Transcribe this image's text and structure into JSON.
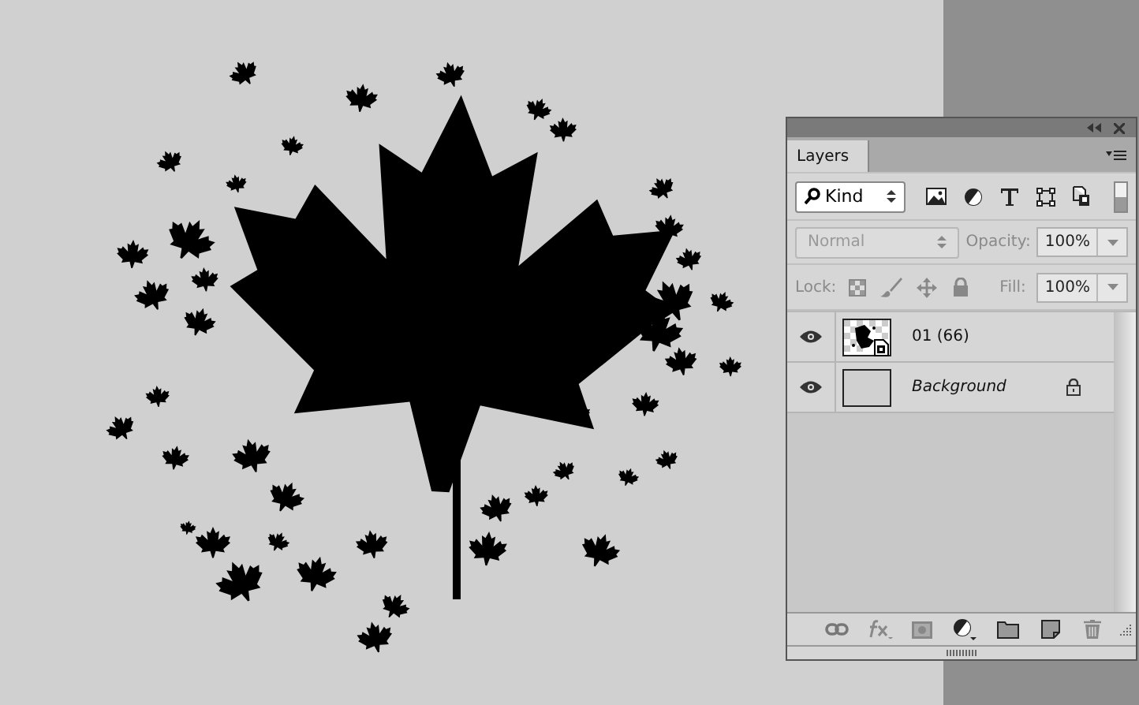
{
  "panel": {
    "tab": "Layers",
    "filter": {
      "label": "Kind",
      "on": true
    },
    "blend_mode": {
      "value": "Normal",
      "disabled": true
    },
    "opacity": {
      "label": "Opacity:",
      "value": "100%"
    },
    "lock": {
      "label": "Lock:"
    },
    "fill": {
      "label": "Fill:",
      "value": "100%"
    },
    "layers": [
      {
        "name": "01 (66)",
        "visible": true,
        "kind": "smart",
        "locked": false
      },
      {
        "name": "Background",
        "visible": true,
        "kind": "background",
        "locked": true
      }
    ]
  }
}
